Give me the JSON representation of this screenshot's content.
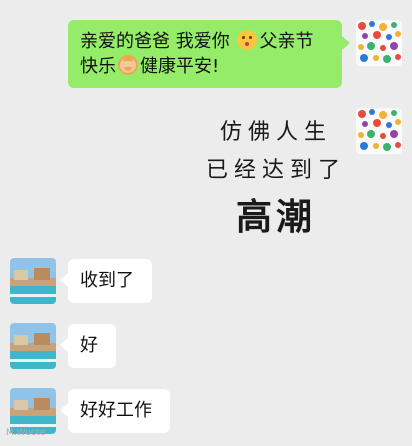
{
  "messages": [
    {
      "side": "right",
      "line1": {
        "text": "亲爱的爸爸 我爱你 ",
        "emoji": "kissing-face",
        "text_after": "父亲节"
      },
      "line2": {
        "text_before": "快乐",
        "emoji": "man-face",
        "text": "健康平安!"
      }
    },
    {
      "side": "right",
      "sticker": {
        "line1": "仿佛人生",
        "line2": "已经达到了",
        "line3": "高潮"
      }
    },
    {
      "side": "left",
      "text": "收到了"
    },
    {
      "side": "left",
      "text": "好"
    },
    {
      "side": "left",
      "text": "好好工作"
    }
  ],
  "watermark": "M.Wuote",
  "colors": {
    "background": "#ececec",
    "outgoing_bubble": "#95ec69",
    "incoming_bubble": "#ffffff"
  }
}
